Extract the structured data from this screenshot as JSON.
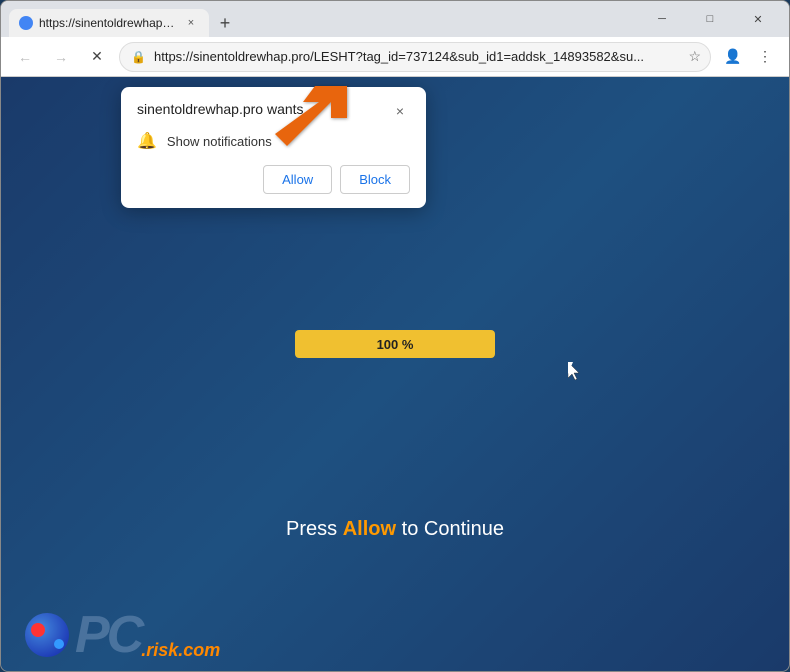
{
  "browser": {
    "tab": {
      "title": "https://sinentoldrewhap.pro/LES",
      "close_label": "×",
      "new_tab_label": "+"
    },
    "controls": {
      "minimize": "─",
      "maximize": "□",
      "close": "✕"
    },
    "nav": {
      "back": "←",
      "forward": "→",
      "reload": "✕"
    },
    "address": {
      "url": "https://sinentoldrewhap.pro/LESHT?tag_id=737124&sub_id1=addsk_14893582&su...",
      "lock_icon": "🔒",
      "star_icon": "☆"
    },
    "toolbar": {
      "profile_icon": "👤",
      "menu_icon": "⋮"
    }
  },
  "notification_popup": {
    "title": "sinentoldrewhap.pro wants",
    "close_label": "×",
    "notification_text": "Show notifications",
    "allow_label": "Allow",
    "block_label": "Block"
  },
  "page": {
    "progress": {
      "value": "100 %"
    },
    "press_allow": {
      "before": "Press",
      "allow_word": "Allow",
      "after": "to Continue"
    }
  },
  "logo": {
    "pc_text": "PC",
    "risk_text": ".risk.com"
  }
}
